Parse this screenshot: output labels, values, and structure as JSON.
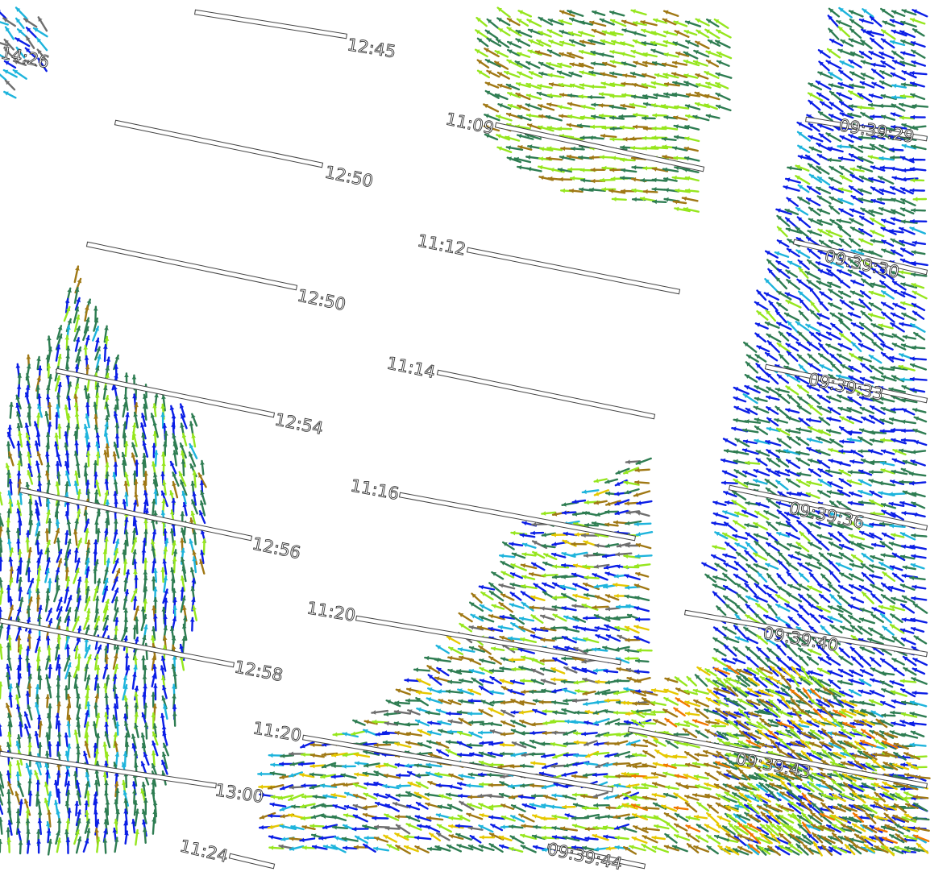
{
  "map": {
    "palette": {
      "blue": "#0b1ee6",
      "cyan": "#1eb4dc",
      "green": "#2e7d52",
      "lime": "#96e61e",
      "olive": "#a07814",
      "yellow": "#e6c800",
      "orange": "#f07800",
      "gray": "#6e6e6e",
      "track_outline": "#444444"
    },
    "tracks": [
      {
        "id": "t1",
        "label": "12:45"
      },
      {
        "id": "t2",
        "label": "12:50"
      },
      {
        "id": "t3",
        "label": "12:50"
      },
      {
        "id": "t4",
        "label": "12:54"
      },
      {
        "id": "t5",
        "label": "12:56"
      },
      {
        "id": "t6",
        "label": "12:58"
      },
      {
        "id": "t7",
        "label": "13:00"
      },
      {
        "id": "t8",
        "label": "11:09"
      },
      {
        "id": "t9",
        "label": "11:12"
      },
      {
        "id": "t10",
        "label": "11:14"
      },
      {
        "id": "t11",
        "label": "11:16"
      },
      {
        "id": "t12",
        "label": "11:20"
      },
      {
        "id": "t13",
        "label": "11:20"
      },
      {
        "id": "t14",
        "label": "11:24"
      },
      {
        "id": "t15",
        "label": "09:39:29"
      },
      {
        "id": "t16",
        "label": "09:39:30"
      },
      {
        "id": "t17",
        "label": "09:39:33"
      },
      {
        "id": "t18",
        "label": "09:39:36"
      },
      {
        "id": "t19",
        "label": "09:39:40"
      },
      {
        "id": "t20",
        "label": "09:39:43"
      },
      {
        "id": "t21",
        "label": "09:39:44"
      },
      {
        "id": "t22",
        "label": "14:26"
      }
    ]
  }
}
